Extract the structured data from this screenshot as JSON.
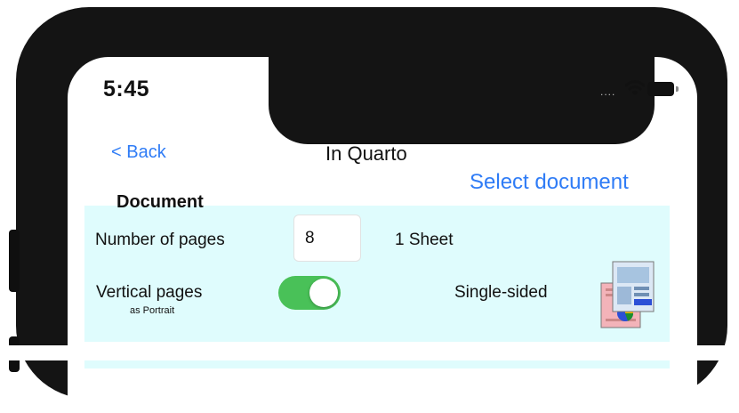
{
  "status_bar": {
    "time": "5:45",
    "signal": "....",
    "icons": [
      "wifi-icon",
      "battery-icon"
    ]
  },
  "nav": {
    "back_label": "< Back",
    "title": "In Quarto",
    "select_document_label": "Select document"
  },
  "document": {
    "section_title": "Document",
    "pages_label": "Number of pages",
    "pages_value": "8",
    "sheets_text": "1 Sheet",
    "vertical_label": "Vertical pages",
    "vertical_sub": "as Portrait",
    "vertical_on": true,
    "sided_label": "Single-sided",
    "sided_icon": "single-sided-document-icon"
  },
  "colors": {
    "accent": "#2f7cf6",
    "panel_bg": "#dffcfd",
    "toggle_on": "#49c158",
    "frame": "#141414"
  }
}
